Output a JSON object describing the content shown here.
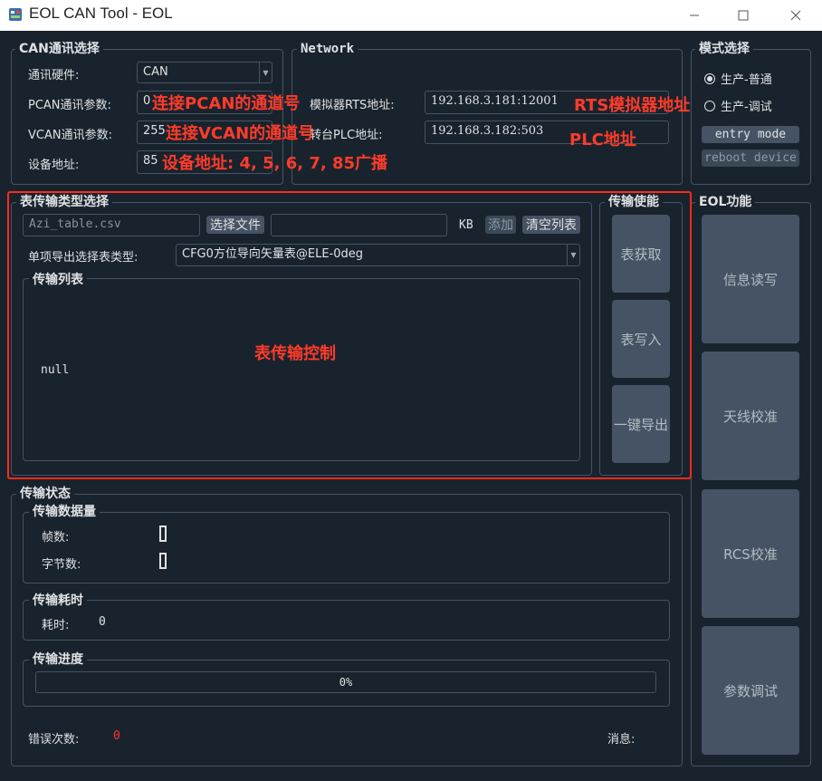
{
  "window": {
    "title": "EOL CAN Tool - EOL",
    "minimize": "—",
    "maximize": "☐",
    "close": "✕"
  },
  "can_group": {
    "title": "CAN通讯选择",
    "hardware_label": "通讯硬件:",
    "hardware_value": "CAN",
    "pcan_label": "PCAN通讯参数:",
    "pcan_value": "0",
    "vcan_label": "VCAN通讯参数:",
    "vcan_value": "255",
    "addr_label": "设备地址:",
    "addr_value": "85"
  },
  "network_group": {
    "title": "Network",
    "rts_label": "模拟器RTS地址:",
    "rts_value": "192.168.3.181:12001",
    "plc_label": "转台PLC地址:",
    "plc_value": "192.168.3.182:503"
  },
  "mode_group": {
    "title": "模式选择",
    "options": [
      "生产-普通",
      "生产-调试"
    ],
    "selected_index": 0,
    "entry_button": "entry mode",
    "reboot_button": "reboot device"
  },
  "table_group": {
    "title": "表传输类型选择",
    "file_placeholder": "Azi_table.csv",
    "choose_file_button": "选择文件",
    "size_value": "",
    "size_unit": "KB",
    "add_button": "添加",
    "clear_button": "清空列表",
    "export_type_label": "单项导出选择表类型:",
    "export_type_value": "CFG0方位导向矢量表@ELE-0deg",
    "list_title": "传输列表",
    "list_content": "null"
  },
  "enable_group": {
    "title": "传输使能",
    "get_table": "表获取",
    "write_table": "表写入",
    "one_key_export": "一键导出"
  },
  "eol_group": {
    "title": "EOL功能",
    "buttons": [
      "信息读写",
      "天线校准",
      "RCS校准",
      "参数调试"
    ]
  },
  "status_group": {
    "title": "传输状态",
    "data_title": "传输数据量",
    "frames_label": "帧数:",
    "bytes_label": "字节数:",
    "time_title": "传输耗时",
    "time_label": "耗时:",
    "time_value": "0",
    "progress_title": "传输进度",
    "progress_text": "0%",
    "progress_value": 0,
    "error_label": "错误次数:",
    "error_value": "0",
    "message_label": "消息:"
  },
  "annotations": {
    "pcan": "连接PCAN的通道号",
    "vcan": "连接VCAN的通道号",
    "addr": "设备地址: 4, 5, 6, 7, 85广播",
    "rts": "RTS模拟器地址",
    "plc": "PLC地址",
    "table": "表传输控制"
  },
  "colors": {
    "background": "#19232d",
    "border": "#455364",
    "button": "#455364",
    "annotation_red": "#ff2a1a",
    "error_value": "#ff3333"
  }
}
